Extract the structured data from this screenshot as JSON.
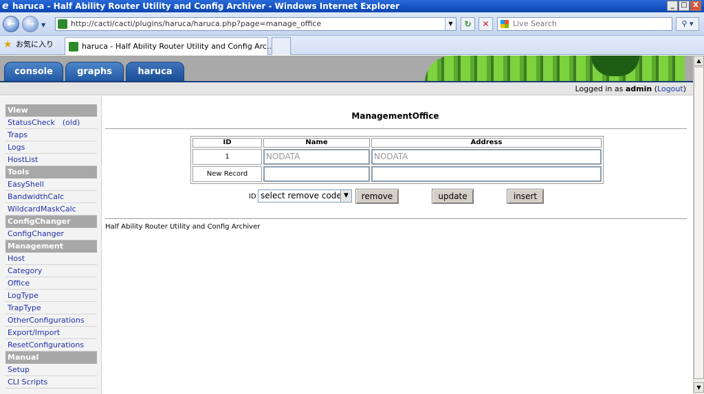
{
  "window": {
    "title": "haruca - Half Ability Router Utility and Config Archiver - Windows Internet Explorer",
    "min": "_",
    "max": "□",
    "close": "X"
  },
  "browser": {
    "url": "http://cacti/cacti/plugins/haruca/haruca.php?page=manage_office",
    "search_placeholder": "Live Search",
    "favorites_label": "お気に入り",
    "tab_title": "haruca - Half Ability Router Utility and Config Arc..."
  },
  "cacti": {
    "tabs": [
      {
        "label": "console"
      },
      {
        "label": "graphs"
      },
      {
        "label": "haruca"
      }
    ],
    "login": {
      "prefix": "Logged in as",
      "user": "admin",
      "logout": "Logout"
    }
  },
  "sidebar": {
    "sections": [
      {
        "header": "View",
        "items": [
          "StatusCheck　(old)",
          "Traps",
          "Logs",
          "HostList"
        ]
      },
      {
        "header": "Tools",
        "items": [
          "EasyShell",
          "BandwidthCalc",
          "WildcardMaskCalc"
        ]
      },
      {
        "header": "ConfigChanger",
        "items": [
          "ConfigChanger"
        ]
      },
      {
        "header": "Management",
        "items": [
          "Host",
          "Category",
          "Office",
          "LogType",
          "TrapType",
          "OtherConfigurations",
          "Export/Import",
          "ResetConfigurations"
        ]
      },
      {
        "header": "Manual",
        "items": [
          "Setup",
          "CLI Scripts"
        ]
      }
    ]
  },
  "main": {
    "title": "ManagementOffice",
    "table": {
      "headers": [
        "ID",
        "Name",
        "Address"
      ],
      "rows": [
        {
          "id": "1",
          "name": "NODATA",
          "address": "NODATA"
        },
        {
          "id": "New Record",
          "name": "",
          "address": ""
        }
      ]
    },
    "actions": {
      "id_label": "ID",
      "select_value": "select remove code",
      "remove": "remove",
      "update": "update",
      "insert": "insert"
    },
    "footer": "Half Ability Router Utility and Config Archiver"
  }
}
